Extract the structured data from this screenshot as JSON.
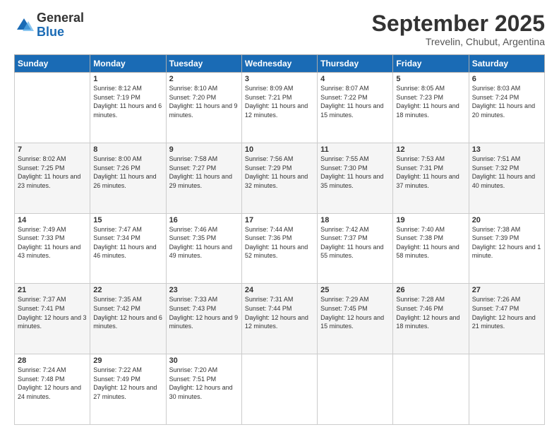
{
  "logo": {
    "general": "General",
    "blue": "Blue"
  },
  "title": "September 2025",
  "location": "Trevelin, Chubut, Argentina",
  "headers": [
    "Sunday",
    "Monday",
    "Tuesday",
    "Wednesday",
    "Thursday",
    "Friday",
    "Saturday"
  ],
  "weeks": [
    [
      {
        "day": "",
        "sunrise": "",
        "sunset": "",
        "daylight": ""
      },
      {
        "day": "1",
        "sunrise": "Sunrise: 8:12 AM",
        "sunset": "Sunset: 7:19 PM",
        "daylight": "Daylight: 11 hours and 6 minutes."
      },
      {
        "day": "2",
        "sunrise": "Sunrise: 8:10 AM",
        "sunset": "Sunset: 7:20 PM",
        "daylight": "Daylight: 11 hours and 9 minutes."
      },
      {
        "day": "3",
        "sunrise": "Sunrise: 8:09 AM",
        "sunset": "Sunset: 7:21 PM",
        "daylight": "Daylight: 11 hours and 12 minutes."
      },
      {
        "day": "4",
        "sunrise": "Sunrise: 8:07 AM",
        "sunset": "Sunset: 7:22 PM",
        "daylight": "Daylight: 11 hours and 15 minutes."
      },
      {
        "day": "5",
        "sunrise": "Sunrise: 8:05 AM",
        "sunset": "Sunset: 7:23 PM",
        "daylight": "Daylight: 11 hours and 18 minutes."
      },
      {
        "day": "6",
        "sunrise": "Sunrise: 8:03 AM",
        "sunset": "Sunset: 7:24 PM",
        "daylight": "Daylight: 11 hours and 20 minutes."
      }
    ],
    [
      {
        "day": "7",
        "sunrise": "Sunrise: 8:02 AM",
        "sunset": "Sunset: 7:25 PM",
        "daylight": "Daylight: 11 hours and 23 minutes."
      },
      {
        "day": "8",
        "sunrise": "Sunrise: 8:00 AM",
        "sunset": "Sunset: 7:26 PM",
        "daylight": "Daylight: 11 hours and 26 minutes."
      },
      {
        "day": "9",
        "sunrise": "Sunrise: 7:58 AM",
        "sunset": "Sunset: 7:27 PM",
        "daylight": "Daylight: 11 hours and 29 minutes."
      },
      {
        "day": "10",
        "sunrise": "Sunrise: 7:56 AM",
        "sunset": "Sunset: 7:29 PM",
        "daylight": "Daylight: 11 hours and 32 minutes."
      },
      {
        "day": "11",
        "sunrise": "Sunrise: 7:55 AM",
        "sunset": "Sunset: 7:30 PM",
        "daylight": "Daylight: 11 hours and 35 minutes."
      },
      {
        "day": "12",
        "sunrise": "Sunrise: 7:53 AM",
        "sunset": "Sunset: 7:31 PM",
        "daylight": "Daylight: 11 hours and 37 minutes."
      },
      {
        "day": "13",
        "sunrise": "Sunrise: 7:51 AM",
        "sunset": "Sunset: 7:32 PM",
        "daylight": "Daylight: 11 hours and 40 minutes."
      }
    ],
    [
      {
        "day": "14",
        "sunrise": "Sunrise: 7:49 AM",
        "sunset": "Sunset: 7:33 PM",
        "daylight": "Daylight: 11 hours and 43 minutes."
      },
      {
        "day": "15",
        "sunrise": "Sunrise: 7:47 AM",
        "sunset": "Sunset: 7:34 PM",
        "daylight": "Daylight: 11 hours and 46 minutes."
      },
      {
        "day": "16",
        "sunrise": "Sunrise: 7:46 AM",
        "sunset": "Sunset: 7:35 PM",
        "daylight": "Daylight: 11 hours and 49 minutes."
      },
      {
        "day": "17",
        "sunrise": "Sunrise: 7:44 AM",
        "sunset": "Sunset: 7:36 PM",
        "daylight": "Daylight: 11 hours and 52 minutes."
      },
      {
        "day": "18",
        "sunrise": "Sunrise: 7:42 AM",
        "sunset": "Sunset: 7:37 PM",
        "daylight": "Daylight: 11 hours and 55 minutes."
      },
      {
        "day": "19",
        "sunrise": "Sunrise: 7:40 AM",
        "sunset": "Sunset: 7:38 PM",
        "daylight": "Daylight: 11 hours and 58 minutes."
      },
      {
        "day": "20",
        "sunrise": "Sunrise: 7:38 AM",
        "sunset": "Sunset: 7:39 PM",
        "daylight": "Daylight: 12 hours and 1 minute."
      }
    ],
    [
      {
        "day": "21",
        "sunrise": "Sunrise: 7:37 AM",
        "sunset": "Sunset: 7:41 PM",
        "daylight": "Daylight: 12 hours and 3 minutes."
      },
      {
        "day": "22",
        "sunrise": "Sunrise: 7:35 AM",
        "sunset": "Sunset: 7:42 PM",
        "daylight": "Daylight: 12 hours and 6 minutes."
      },
      {
        "day": "23",
        "sunrise": "Sunrise: 7:33 AM",
        "sunset": "Sunset: 7:43 PM",
        "daylight": "Daylight: 12 hours and 9 minutes."
      },
      {
        "day": "24",
        "sunrise": "Sunrise: 7:31 AM",
        "sunset": "Sunset: 7:44 PM",
        "daylight": "Daylight: 12 hours and 12 minutes."
      },
      {
        "day": "25",
        "sunrise": "Sunrise: 7:29 AM",
        "sunset": "Sunset: 7:45 PM",
        "daylight": "Daylight: 12 hours and 15 minutes."
      },
      {
        "day": "26",
        "sunrise": "Sunrise: 7:28 AM",
        "sunset": "Sunset: 7:46 PM",
        "daylight": "Daylight: 12 hours and 18 minutes."
      },
      {
        "day": "27",
        "sunrise": "Sunrise: 7:26 AM",
        "sunset": "Sunset: 7:47 PM",
        "daylight": "Daylight: 12 hours and 21 minutes."
      }
    ],
    [
      {
        "day": "28",
        "sunrise": "Sunrise: 7:24 AM",
        "sunset": "Sunset: 7:48 PM",
        "daylight": "Daylight: 12 hours and 24 minutes."
      },
      {
        "day": "29",
        "sunrise": "Sunrise: 7:22 AM",
        "sunset": "Sunset: 7:49 PM",
        "daylight": "Daylight: 12 hours and 27 minutes."
      },
      {
        "day": "30",
        "sunrise": "Sunrise: 7:20 AM",
        "sunset": "Sunset: 7:51 PM",
        "daylight": "Daylight: 12 hours and 30 minutes."
      },
      {
        "day": "",
        "sunrise": "",
        "sunset": "",
        "daylight": ""
      },
      {
        "day": "",
        "sunrise": "",
        "sunset": "",
        "daylight": ""
      },
      {
        "day": "",
        "sunrise": "",
        "sunset": "",
        "daylight": ""
      },
      {
        "day": "",
        "sunrise": "",
        "sunset": "",
        "daylight": ""
      }
    ]
  ]
}
